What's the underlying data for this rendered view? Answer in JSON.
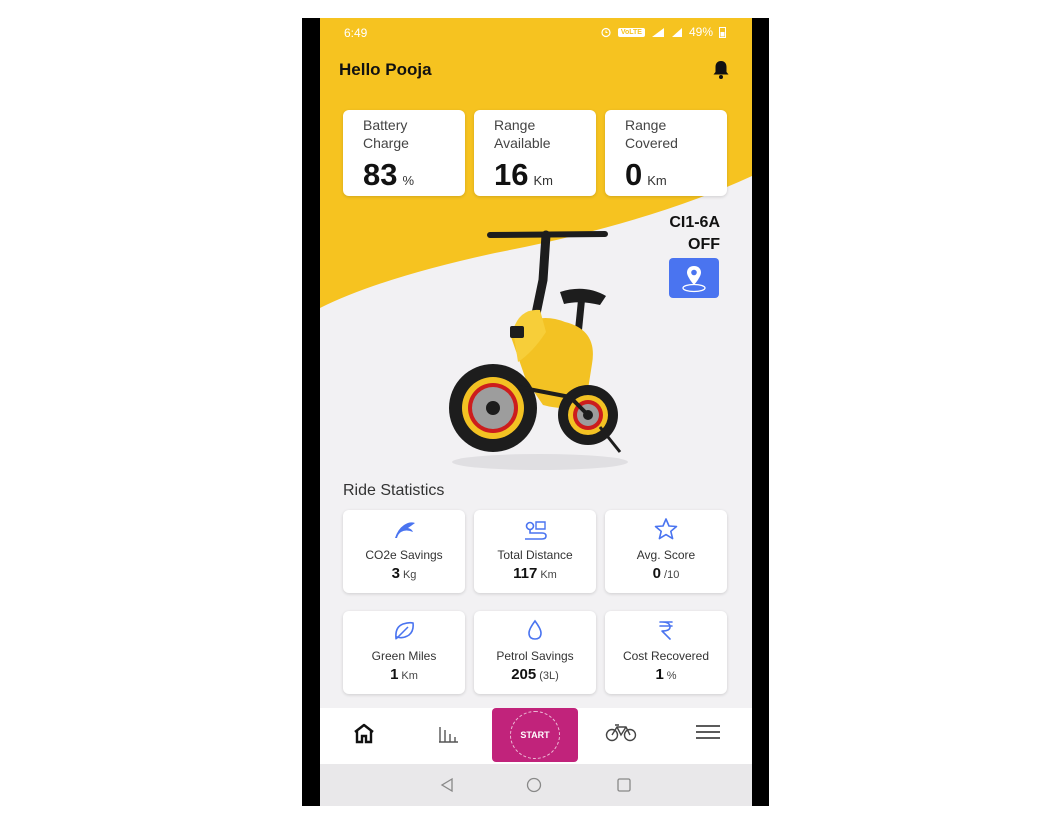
{
  "status_bar": {
    "time": "6:49",
    "network_badge": "VoLTE",
    "battery": "49%"
  },
  "header": {
    "greeting": "Hello Pooja"
  },
  "stats": [
    {
      "label": "Battery Charge",
      "value": "83",
      "unit": "%"
    },
    {
      "label": "Range Available",
      "value": "16",
      "unit": "Km"
    },
    {
      "label": "Range Covered",
      "value": "0",
      "unit": "Km"
    }
  ],
  "device": {
    "id": "CI1-6A",
    "status": "OFF"
  },
  "ride_statistics": {
    "title": "Ride Statistics",
    "items": [
      {
        "label": "CO2e Savings",
        "value": "3",
        "unit": "Kg",
        "icon": "leaf-curl-icon"
      },
      {
        "label": "Total Distance",
        "value": "117",
        "unit": "Km",
        "icon": "route-icon"
      },
      {
        "label": "Avg. Score",
        "value": "0",
        "unit": "/10",
        "icon": "star-icon"
      },
      {
        "label": "Green Miles",
        "value": "1",
        "unit": "Km",
        "icon": "leaf-icon"
      },
      {
        "label": "Petrol Savings",
        "value": "205",
        "unit": "(3L)",
        "icon": "drop-icon"
      },
      {
        "label": "Cost Recovered",
        "value": "1",
        "unit": "%",
        "icon": "rupee-icon"
      }
    ]
  },
  "bottom_nav": {
    "start_label": "START",
    "active": "home"
  },
  "colors": {
    "brand_yellow": "#f6c320",
    "accent_blue": "#4a74f0",
    "start_magenta": "#c1237b"
  }
}
